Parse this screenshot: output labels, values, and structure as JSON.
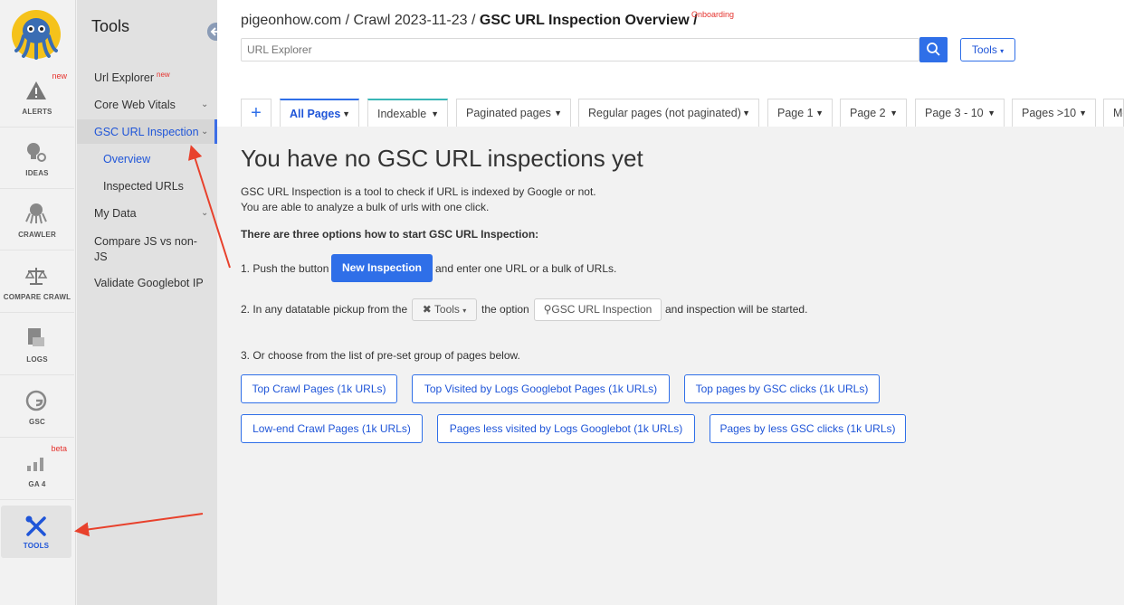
{
  "rail": {
    "items": [
      {
        "label": "ALERTS",
        "icon": "warning-icon",
        "badge": "new"
      },
      {
        "label": "IDEAS",
        "icon": "lightbulb-gear-icon",
        "badge": ""
      },
      {
        "label": "CRAWLER",
        "icon": "octopus-icon",
        "badge": ""
      },
      {
        "label": "COMPARE CRAWL",
        "icon": "scales-icon",
        "badge": ""
      },
      {
        "label": "LOGS",
        "icon": "log-file-icon",
        "badge": ""
      },
      {
        "label": "GSC",
        "icon": "google-icon",
        "badge": ""
      },
      {
        "label": "GA 4",
        "icon": "bar-chart-icon",
        "badge": "beta"
      },
      {
        "label": "TOOLS",
        "icon": "wrench-screwdriver-icon",
        "badge": ""
      }
    ],
    "active": "TOOLS"
  },
  "sidebar": {
    "title": "Tools",
    "items": [
      {
        "label": "Url Explorer",
        "badge": "new"
      },
      {
        "label": "Core Web Vitals"
      },
      {
        "label": "GSC URL Inspection"
      },
      {
        "label": "Overview"
      },
      {
        "label": "Inspected URLs"
      },
      {
        "label": "My Data"
      },
      {
        "label": "Compare JS vs non-JS"
      },
      {
        "label": "Validate Googlebot IP"
      }
    ]
  },
  "header": {
    "crumb1": "pigeonhow.com /",
    "crumb2": "Crawl 2023-11-23 /",
    "crumb3": "GSC URL Inspection Overview /",
    "onboarding": "Onboarding",
    "search_placeholder": "URL Explorer",
    "tools_label": "Tools"
  },
  "tabs": [
    {
      "label": "All Pages",
      "active": true
    },
    {
      "label": "Indexable"
    },
    {
      "label": "Paginated pages"
    },
    {
      "label": "Regular pages (not paginated)"
    },
    {
      "label": "Page 1"
    },
    {
      "label": "Page 2"
    },
    {
      "label": "Page 3 - 10"
    },
    {
      "label": "Pages >10"
    },
    {
      "label": "Mo"
    }
  ],
  "content": {
    "heading": "You have no GSC URL inspections yet",
    "intro1": "GSC URL Inspection is a tool to check if URL is indexed by Google or not.",
    "intro2": "You are able to analyze a bulk of urls with one click.",
    "options_title": "There are three options how to start GSC URL Inspection:",
    "opt1_pre": "1. Push the button",
    "opt1_btn": "New Inspection",
    "opt1_post": "and enter one URL or a bulk of URLs.",
    "opt2_pre": "2. In any datatable pickup from the",
    "opt2_tools": "Tools",
    "opt2_mid": "the option",
    "opt2_gsc": "GSC URL Inspection",
    "opt2_post": "and inspection will be started.",
    "opt3": "3. Or choose from the list of pre-set group of pages below.",
    "presets": [
      "Top Crawl Pages (1k URLs)",
      "Top Visited by Logs Googlebot Pages (1k URLs)",
      "Top pages by GSC clicks (1k URLs)",
      "Low-end Crawl Pages (1k URLs)",
      "Pages less visited by Logs Googlebot (1k URLs)",
      "Pages by less GSC clicks (1k URLs)"
    ]
  },
  "colors": {
    "accent": "#2f6fe8",
    "badge": "#e5322d",
    "annotation_arrow": "#e8412c"
  }
}
